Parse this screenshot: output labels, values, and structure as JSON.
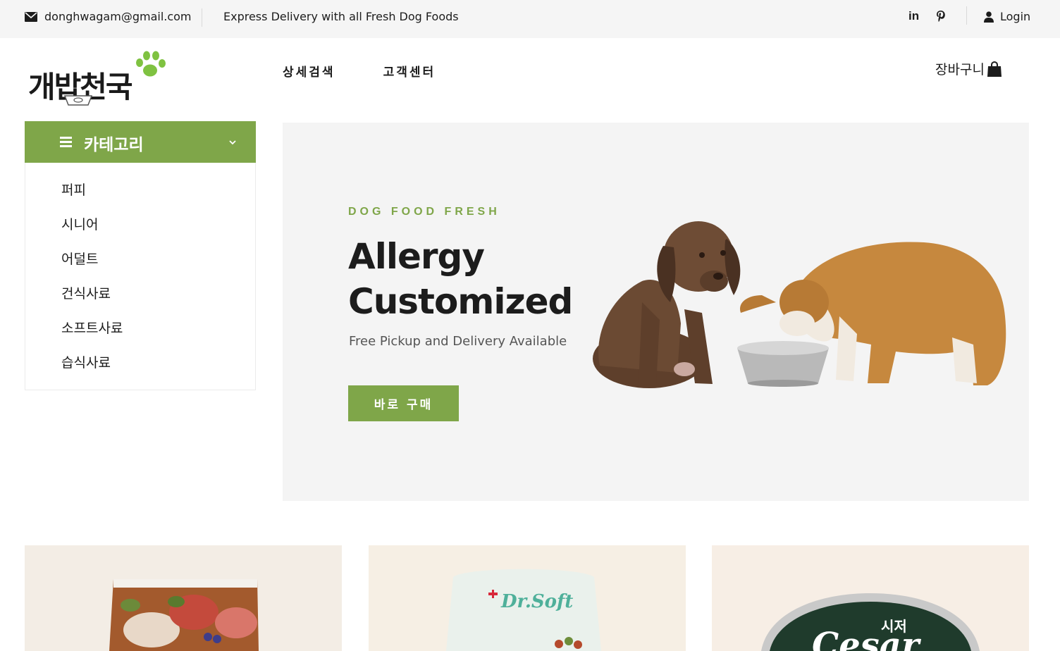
{
  "topbar": {
    "email": "donghwagam@gmail.com",
    "tagline": "Express Delivery with all Fresh Dog Foods",
    "social": [
      {
        "icon": "linkedin-icon",
        "glyph": "in"
      },
      {
        "icon": "pinterest-icon",
        "glyph": "P"
      }
    ],
    "login_label": "Login"
  },
  "header": {
    "logo_text": "개밥천국",
    "nav": [
      {
        "label": "상세검색"
      },
      {
        "label": "고객센터"
      }
    ],
    "cart_label": "장바구니"
  },
  "sidebar": {
    "title": "카테고리",
    "items": [
      {
        "label": "퍼피"
      },
      {
        "label": "시니어"
      },
      {
        "label": "어덜트"
      },
      {
        "label": "건식사료"
      },
      {
        "label": "소프트사료"
      },
      {
        "label": "습식사료"
      }
    ]
  },
  "hero": {
    "kicker": "DOG FOOD FRESH",
    "title_line1": "Allergy",
    "title_line2": "Customized",
    "subtitle": "Free Pickup and Delivery Available",
    "button_label": "바로 구매"
  },
  "products": {
    "card2_brand": "Dr.Soft",
    "card3_brand": "Cesar",
    "card3_korean": "시저"
  },
  "colors": {
    "accent": "#7fa649",
    "topbar_bg": "#f5f5f5",
    "hero_bg": "#f4f4f4"
  }
}
